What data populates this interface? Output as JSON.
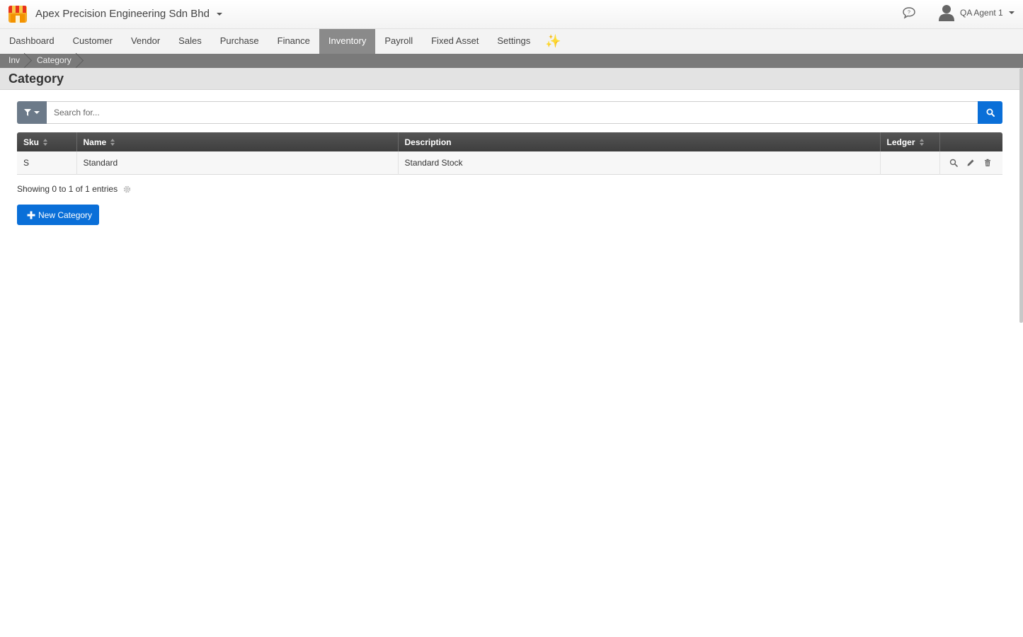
{
  "topbar": {
    "company_name": "Apex Precision Engineering Sdn Bhd",
    "user_name": "QA Agent 1"
  },
  "nav": {
    "items": [
      "Dashboard",
      "Customer",
      "Vendor",
      "Sales",
      "Purchase",
      "Finance",
      "Inventory",
      "Payroll",
      "Fixed Asset",
      "Settings"
    ],
    "active": "Inventory",
    "sparkle_icon": "sparkle-icon"
  },
  "breadcrumb": [
    "Inv",
    "Category"
  ],
  "page_title": "Category",
  "search": {
    "placeholder": "Search for..."
  },
  "table": {
    "columns": [
      "Sku",
      "Name",
      "Description",
      "Ledger"
    ],
    "rows": [
      {
        "sku": "S",
        "name": "Standard",
        "description": "Standard Stock",
        "ledger": ""
      }
    ]
  },
  "info_text": "Showing 0 to 1 of 1 entries",
  "new_button_label": "New Category",
  "colors": {
    "primary": "#0a6fd8",
    "nav_active": "#8a8a8a",
    "table_header": "#444444",
    "filter_button": "#6c7a89"
  }
}
